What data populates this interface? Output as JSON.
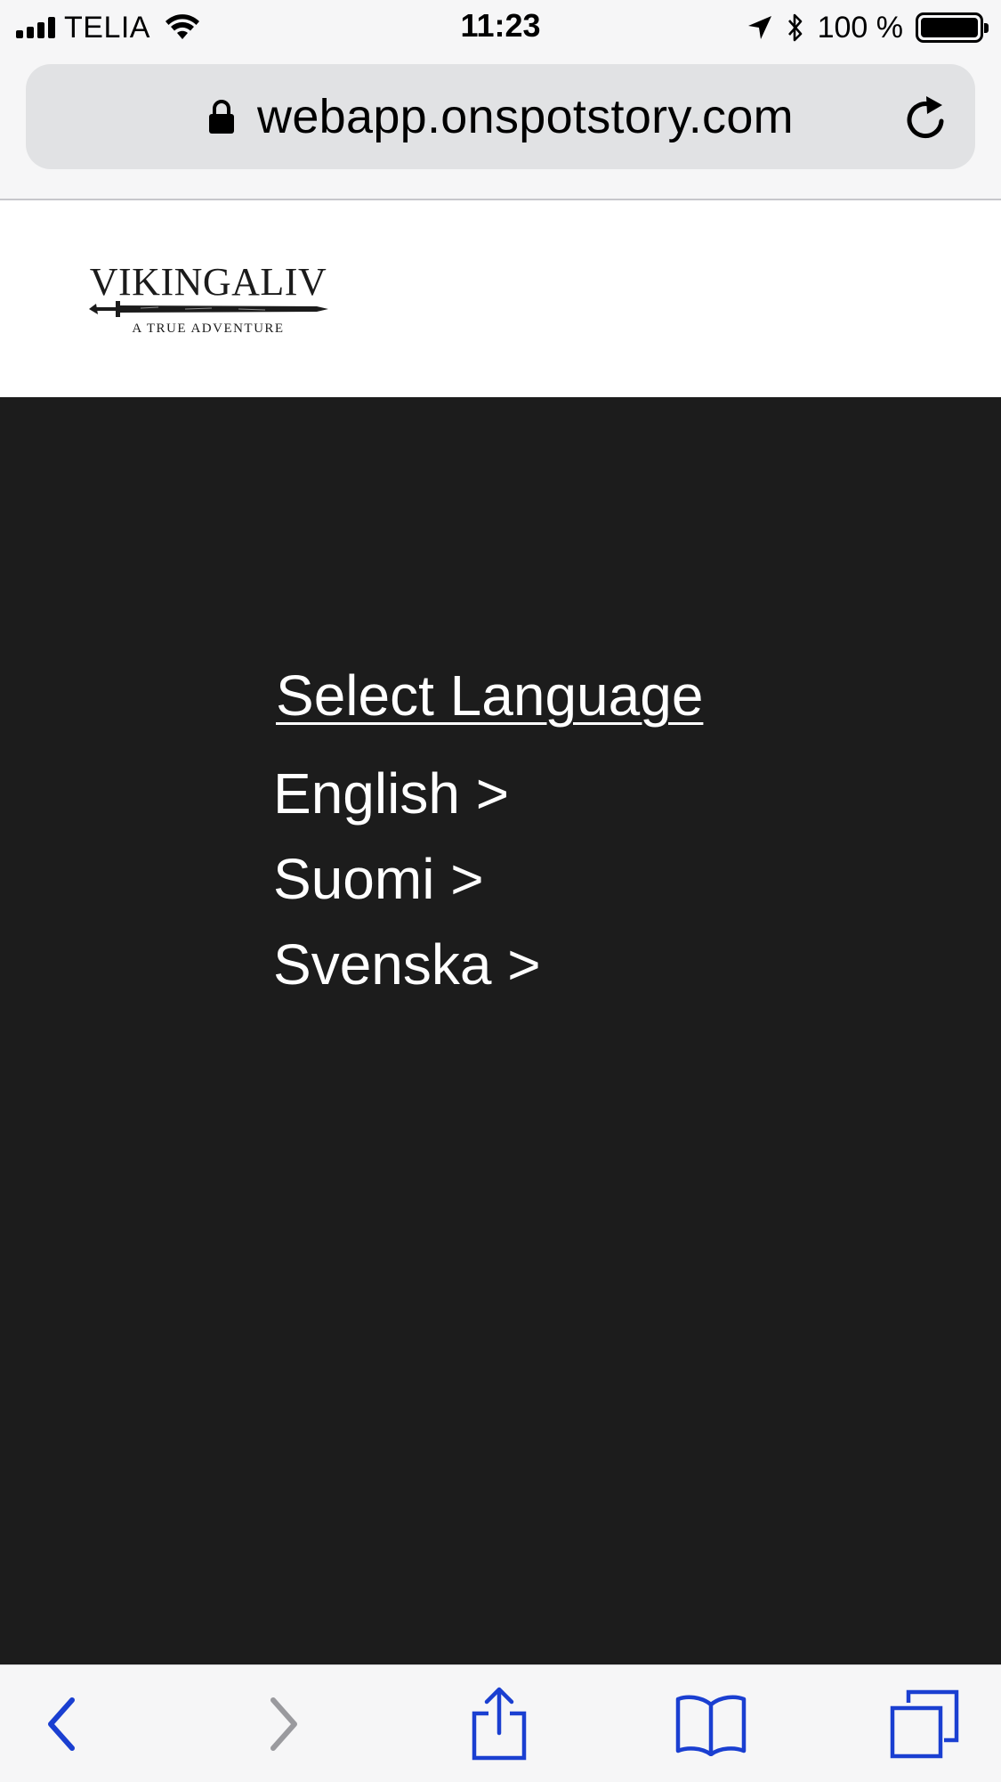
{
  "status_bar": {
    "carrier": "TELIA",
    "time": "11:23",
    "battery": "100 %",
    "battery_level_percent": 100,
    "icons": [
      "signal-icon",
      "wifi-icon",
      "location-arrow-icon",
      "bluetooth-icon",
      "battery-icon"
    ]
  },
  "url_bar": {
    "url": "webapp.onspotstory.com",
    "icons": [
      "lock-icon",
      "reload-icon"
    ]
  },
  "site": {
    "logo_title": "VIKINGALIV",
    "logo_subtitle": "A TRUE ADVENTURE"
  },
  "language": {
    "heading": "Select Language",
    "options": [
      {
        "label": "English >"
      },
      {
        "label": "Suomi >"
      },
      {
        "label": "Svenska >"
      }
    ]
  },
  "toolbar": {
    "icons": [
      "back-icon",
      "forward-icon",
      "share-icon",
      "bookmarks-icon",
      "tabs-icon"
    ],
    "accent_color": "#1a3fd1",
    "disabled_color": "#9a9a9e"
  },
  "colors": {
    "content_background": "#1c1c1c",
    "chrome_background": "#f6f6f7",
    "url_field_background": "#e1e2e4"
  }
}
